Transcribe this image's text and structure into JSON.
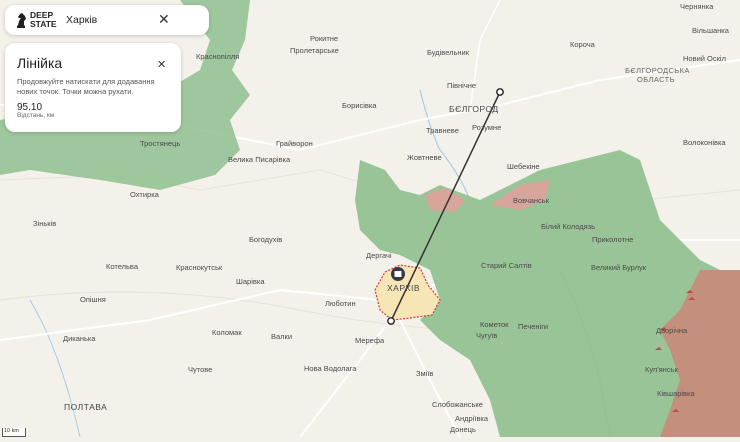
{
  "search": {
    "logo_line1": "DEEP",
    "logo_line2": "STATE",
    "query": "Харків"
  },
  "ruler": {
    "title": "Лінійка",
    "description": "Продовжуйте натискати для додавання нових точок. Точки можна рухати.",
    "distance": "95.10",
    "distance_unit": "Відстань, км"
  },
  "scale": {
    "label": "10 km"
  },
  "map": {
    "city_labels": {
      "kharkiv": "ХАРКІВ",
      "belgorod": "БЄЛГОРОД",
      "belgorod_oblast_1": "БЄЛГОРОДСЬКА",
      "belgorod_oblast_2": "ОБЛАСТЬ",
      "poltava": "ПОЛТАВА"
    },
    "places": {
      "chernianka": "Чернянка",
      "vilshanka": "Вільшанка",
      "rokytne": "Рокитне",
      "proletarske": "Пролетарське",
      "budivelnyk": "Будівельник",
      "korocha": "Короча",
      "novyi_oskil": "Новий Оскіл",
      "krasnopillia": "Краснопілля",
      "pivnichne": "Північне",
      "borysivka": "Борисівка",
      "travneve": "Травневе",
      "rozumne": "Розумне",
      "vovchansk_ru": "Волоконівка",
      "trostianets": "Тростянець",
      "grayvoron": "Грайворон",
      "velyka_pysarivka": "Велика Писарівка",
      "zhovtneve": "Жовтневе",
      "shebekine": "Шебекіне",
      "okhtyrka": "Охтирка",
      "vovchansk": "Вовчанськ",
      "zinkiv": "Зіньків",
      "bohodukhiv": "Богодухів",
      "derhachi": "Дергачі",
      "bilyi_kolodiaz": "Білий Колодязь",
      "prykolotne": "Приколотне",
      "kotelva": "Котельва",
      "krasnokutsk": "Краснокутськ",
      "sharivka": "Шарівка",
      "staryi_saltiv": "Старий Салтів",
      "velykyi_burluk": "Великий Бурлук",
      "opishnia": "Опішня",
      "liubotyn": "Люботин",
      "kolomak": "Коломак",
      "valky": "Валки",
      "kometok": "Кометок",
      "pechenihy": "Печеніги",
      "chuhuiv": "Чугуїв",
      "dvorichna": "Дворічна",
      "dykanka": "Диканька",
      "merefa": "Мерефа",
      "kupiansk": "Куп'янськ",
      "chutove": "Чутове",
      "nova_vodolaha": "Нова Водолага",
      "zmiiv": "Зміїв",
      "kivsharivka": "Ківшарівка",
      "sloboshanske": "Слобожанське",
      "andriivka": "Андріївка",
      "donets": "Донець"
    }
  },
  "colors": {
    "ua_controlled_green": "#8fbf8f",
    "occupied_red": "#c98a7a",
    "contested_pink": "#d7a59b",
    "map_background": "#f3f1ea",
    "ruler_line": "#333333",
    "kharkiv_area": "#f7e6b5",
    "kharkiv_border": "#d4343c"
  },
  "icons": {
    "logo": "deepstate-knight-icon",
    "close_search": "close-icon",
    "close_ruler": "close-icon",
    "city_marker": "building-icon"
  }
}
